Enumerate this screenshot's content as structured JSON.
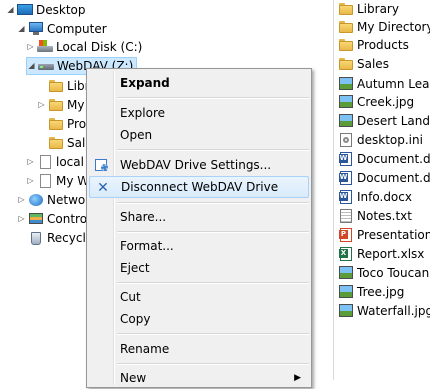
{
  "tree": {
    "items": [
      {
        "label": "Desktop",
        "icon": "desktop-icon",
        "arrow": "◢",
        "level": 0
      },
      {
        "label": "Computer",
        "icon": "computer-icon",
        "arrow": "◢",
        "level": 1
      },
      {
        "label": "Local Disk (C:)",
        "icon": "windows-drive-icon",
        "arrow": "▷",
        "level": 2
      },
      {
        "label": "WebDAV (Z:)",
        "icon": "network-drive-icon",
        "arrow": "◢",
        "level": 2
      },
      {
        "label": "Libr",
        "icon": "folder-icon",
        "arrow": "",
        "level": 3
      },
      {
        "label": "My",
        "icon": "folder-icon",
        "arrow": "▷",
        "level": 3
      },
      {
        "label": "Pro",
        "icon": "folder-icon",
        "arrow": "",
        "level": 3
      },
      {
        "label": "Sal",
        "icon": "folder-icon",
        "arrow": "",
        "level": 3
      },
      {
        "label": "local",
        "icon": "document-icon",
        "arrow": "▷",
        "level": 2
      },
      {
        "label": "My W",
        "icon": "document-icon",
        "arrow": "▷",
        "level": 2
      },
      {
        "label": "Netwo",
        "icon": "network-icon",
        "arrow": "▷",
        "level": 1
      },
      {
        "label": "Contro",
        "icon": "control-panel-icon",
        "arrow": "▷",
        "level": 1
      },
      {
        "label": "Recycle",
        "icon": "recycle-bin-icon",
        "arrow": "",
        "level": 1
      }
    ]
  },
  "files": {
    "items": [
      {
        "label": "Library",
        "icon": "folder-icon"
      },
      {
        "label": "My Directory",
        "icon": "folder-icon"
      },
      {
        "label": "Products",
        "icon": "folder-icon"
      },
      {
        "label": "Sales",
        "icon": "folder-icon"
      },
      {
        "label": "Autumn Leaves",
        "icon": "image-icon"
      },
      {
        "label": "Creek.jpg",
        "icon": "image-icon"
      },
      {
        "label": "Desert Landscape",
        "icon": "image-icon"
      },
      {
        "label": "desktop.ini",
        "icon": "ini-file-icon"
      },
      {
        "label": "Document.docx",
        "icon": "word-icon"
      },
      {
        "label": "Document.docx",
        "icon": "word-icon"
      },
      {
        "label": "Info.docx",
        "icon": "word-icon"
      },
      {
        "label": "Notes.txt",
        "icon": "text-file-icon"
      },
      {
        "label": "Presentation.pptx",
        "icon": "powerpoint-icon"
      },
      {
        "label": "Report.xlsx",
        "icon": "excel-icon"
      },
      {
        "label": "Toco Toucan.jpg",
        "icon": "image-icon"
      },
      {
        "label": "Tree.jpg",
        "icon": "image-icon"
      },
      {
        "label": "Waterfall.jpg",
        "icon": "image-icon"
      }
    ]
  },
  "context_menu": {
    "expand": "Expand",
    "explore": "Explore",
    "open": "Open",
    "webdav_settings": "WebDAV Drive Settings...",
    "disconnect": "Disconnect WebDAV Drive",
    "share": "Share...",
    "format": "Format...",
    "eject": "Eject",
    "cut": "Cut",
    "copy": "Copy",
    "rename": "Rename",
    "new": "New",
    "submenu_arrow": "▶"
  },
  "colors": {
    "selection": "#cce8ff",
    "menu_background": "#f0f0f0",
    "menu_highlight": "#d9ebfb"
  }
}
